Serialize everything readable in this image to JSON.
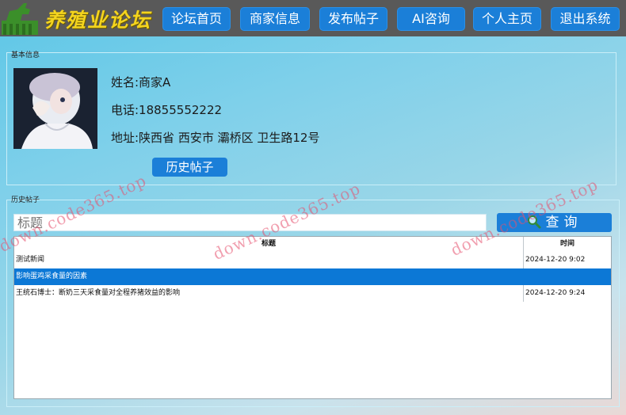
{
  "header": {
    "brand": "养殖业论坛",
    "nav": [
      {
        "label": "论坛首页"
      },
      {
        "label": "商家信息"
      },
      {
        "label": "发布帖子"
      },
      {
        "label": "AI咨询"
      },
      {
        "label": "个人主页"
      },
      {
        "label": "退出系统"
      }
    ]
  },
  "basic_info": {
    "group_title": "基本信息",
    "name_line": "姓名:商家A",
    "phone_line": "电话:18855552222",
    "address_line": "地址:陕西省 西安市 灞桥区 卫生路12号",
    "history_button": "历史帖子"
  },
  "history": {
    "group_title": "历史帖子",
    "search_placeholder": "标题",
    "search_button": "查询",
    "columns": [
      "标题",
      "时间"
    ],
    "rows": [
      {
        "title": "测试新闻",
        "time": "2024-12-20 9:02"
      },
      {
        "title": "影响蛋鸡采食量的因素",
        "time": ""
      },
      {
        "title": "王统石博士：断奶三天采食量对全程养猪效益的影响",
        "time": "2024-12-20 9:24"
      }
    ],
    "selected_row": 1
  },
  "watermark": "down.code365.top",
  "colors": {
    "nav_button": "#1b7fd8",
    "brand_text": "#f4d41e",
    "selected_row": "#0c78d6",
    "topbar": "#595959"
  }
}
